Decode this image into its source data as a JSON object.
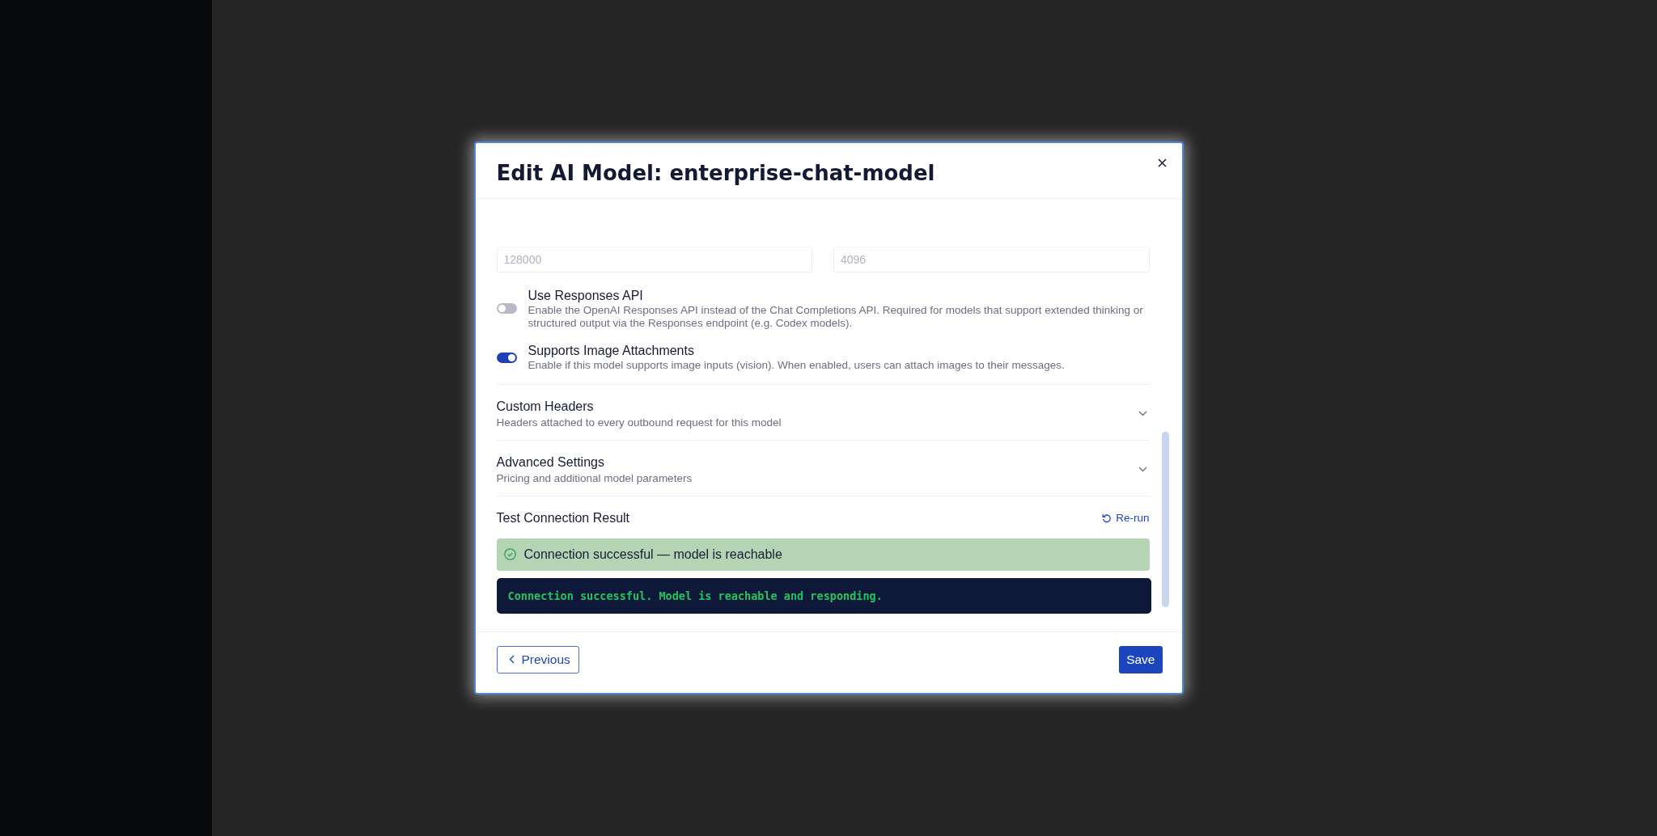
{
  "dialog": {
    "title": "Edit AI Model: enterprise-chat-model"
  },
  "fields": [
    {
      "placeholder": "128000"
    },
    {
      "placeholder": "4096"
    }
  ],
  "toggles": [
    {
      "label": "Use Responses API",
      "description": "Enable the OpenAI Responses API instead of the Chat Completions API. Required for models that support extended thinking or structured output via the Responses endpoint (e.g. Codex models).",
      "on": false
    },
    {
      "label": "Supports Image Attachments",
      "description": "Enable if this model supports image inputs (vision). When enabled, users can attach images to their messages.",
      "on": true
    }
  ],
  "sections": [
    {
      "title": "Custom Headers",
      "description": "Headers attached to every outbound request for this model",
      "expanded": false
    },
    {
      "title": "Advanced Settings",
      "description": "Pricing and additional model parameters",
      "expanded": false
    }
  ],
  "test_result": {
    "title": "Test Connection Result",
    "rerun_label": "Re-run",
    "alert": {
      "kind": "success",
      "message": "Connection successful — model is reachable"
    },
    "output": "Connection successful. Model is reachable and responding."
  },
  "footer": {
    "previous_label": "Previous",
    "save_label": "Save"
  }
}
